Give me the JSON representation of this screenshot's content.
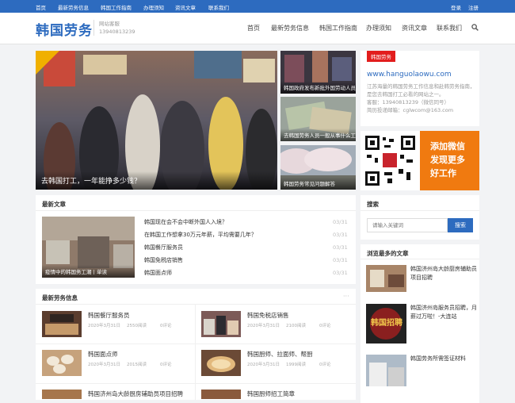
{
  "topbar": {
    "links": [
      "首页",
      "最新劳务信息",
      "韩国工作指南",
      "办理须知",
      "资讯文章",
      "联系我们"
    ],
    "login": "登录",
    "register": "注册"
  },
  "header": {
    "logo": "韩国劳务",
    "site_name": "网站客服",
    "phone": "13940813239"
  },
  "nav": [
    "首页",
    "最新劳务信息",
    "韩国工作指南",
    "办理须知",
    "资讯文章",
    "联系我们"
  ],
  "slider": {
    "main_caption": "去韩国打工，一年能挣多少钱？",
    "side": [
      "韩国政府发布新批外国劳动人员",
      "去韩国劳务人员一般从事什么工作",
      "韩国劳务常见问题解答"
    ]
  },
  "aside": {
    "badge": "韩国劳务",
    "url": "www.hanguolaowu.com",
    "desc": "江苏海量的韩国劳务工作信息和赴韩劳务指南，是您去韩国打工必看的网站之一。",
    "contact": "客服：13940813239（微信同号）",
    "email": "简历投递邮箱：cglwcom@163.com",
    "wechat_lines": [
      "添加微信",
      "发现更多",
      "好工作"
    ],
    "search_title": "搜索",
    "search_placeholder": "请输入关键词",
    "search_button": "搜索",
    "popular_title": "浏览最多的文章",
    "popular": [
      "韩国济州岛大龄厨房辅助员项目招聘",
      "韩国济州岛服务员招聘，月薪过万啦！-大连站",
      "韩国劳务所需签证材料"
    ],
    "popular_img_text": "韩国招聘"
  },
  "latest": {
    "title": "最新文章",
    "img_caption": "疫情中的韩国务工潮丨单读",
    "items": [
      {
        "title": "韩国现在会不会中断外国人入境？",
        "date": "03/31"
      },
      {
        "title": "在韩国工作想拿30万元年薪，平均需要几年？",
        "date": "03/31"
      },
      {
        "title": "韩国餐厅服务员",
        "date": "03/31"
      },
      {
        "title": "韩国免税店销售",
        "date": "03/31"
      },
      {
        "title": "韩国面点师",
        "date": "03/31"
      }
    ]
  },
  "labor": {
    "title": "最新劳务信息",
    "more": "···",
    "cards": [
      {
        "title": "韩国餐厅服务员",
        "date": "2020年3月31日",
        "views": "2550阅读",
        "comments": "0评论"
      },
      {
        "title": "韩国免税店销售",
        "date": "2020年3月31日",
        "views": "2100阅读",
        "comments": "0评论"
      },
      {
        "title": "韩国面点师",
        "date": "2020年3月31日",
        "views": "2015阅读",
        "comments": "0评论"
      },
      {
        "title": "韩国厨师、拉面师、帮厨",
        "date": "2020年3月31日",
        "views": "1999阅读",
        "comments": "0评论"
      },
      {
        "title": "韩国济州岛大龄厨房辅助员项目招聘",
        "date": "",
        "views": "",
        "comments": ""
      },
      {
        "title": "韩国厨师招工简章",
        "date": "",
        "views": "",
        "comments": ""
      }
    ]
  },
  "colors": {
    "brand": "#2d6bbf",
    "accent": "#f07a10",
    "badge": "#e21d1d"
  }
}
